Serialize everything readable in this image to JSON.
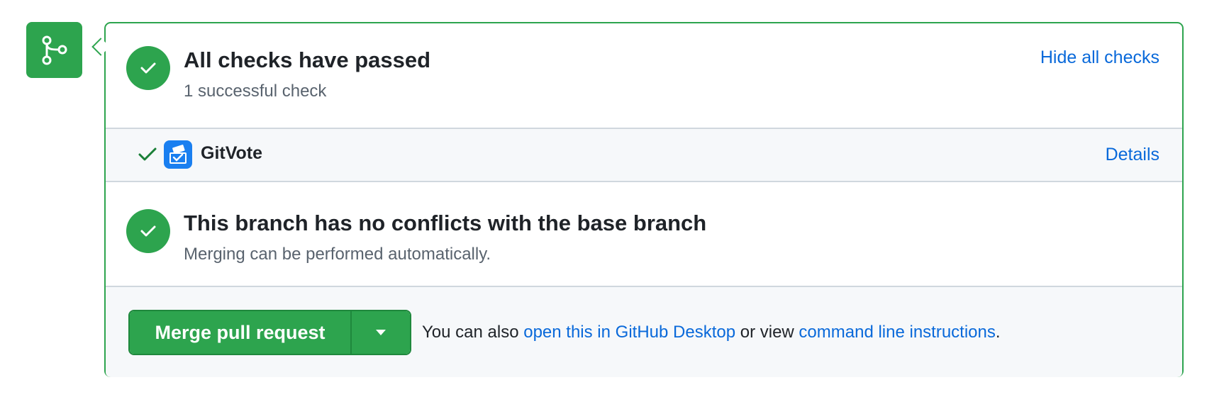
{
  "icons": {
    "merge_tile": "git-branch-icon",
    "check_circle": "check-icon",
    "row_check": "check-icon",
    "app_avatar": "gitvote-icon",
    "caret": "triangle-down-icon"
  },
  "colors": {
    "success": "#2da44e",
    "link": "#0969da",
    "muted": "#59636e"
  },
  "checks": {
    "title": "All checks have passed",
    "subtitle": "1 successful check",
    "toggle_label": "Hide all checks",
    "items": [
      {
        "name": "GitVote",
        "details_label": "Details",
        "status": "success"
      }
    ]
  },
  "branch": {
    "title": "This branch has no conflicts with the base branch",
    "subtitle": "Merging can be performed automatically."
  },
  "merge": {
    "button_label": "Merge pull request",
    "note_prefix": "You can also ",
    "desktop_link": "open this in GitHub Desktop",
    "note_middle": " or view ",
    "cli_link": "command line instructions",
    "note_suffix": "."
  }
}
